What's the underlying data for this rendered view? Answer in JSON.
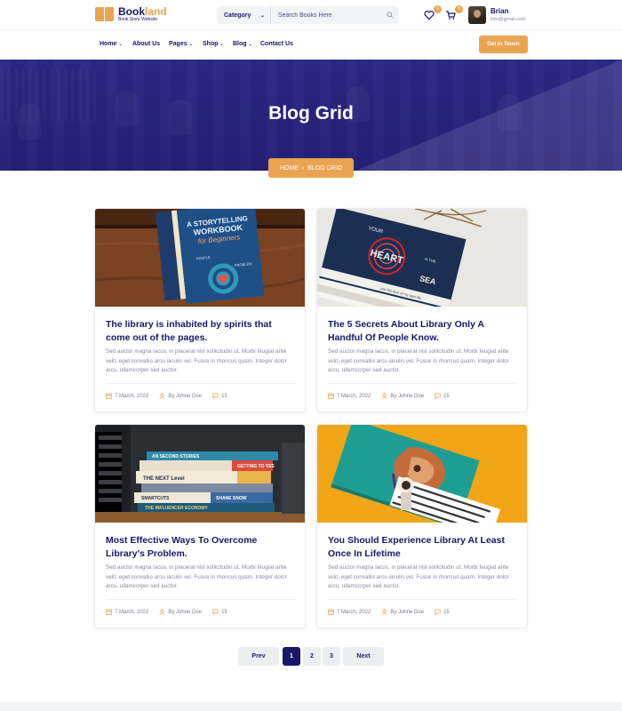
{
  "brand": {
    "name_part1": "Book",
    "name_part2": "land",
    "tagline": "Book Store Website"
  },
  "search": {
    "category_label": "Category",
    "placeholder": "Search Books Here"
  },
  "header": {
    "wishlist_count": "0",
    "cart_count": "5",
    "user_name": "Brian",
    "user_email": "info@gmail.com"
  },
  "nav": {
    "items": [
      {
        "label": "Home"
      },
      {
        "label": "About Us"
      },
      {
        "label": "Pages"
      },
      {
        "label": "Shop"
      },
      {
        "label": "Blog"
      },
      {
        "label": "Contact Us"
      }
    ],
    "cta_label": "Get In Touch"
  },
  "hero": {
    "title": "Blog Grid",
    "breadcrumb_home": "HOME",
    "breadcrumb_current": "BLOG GRID"
  },
  "posts": [
    {
      "title": "The library is inhabited by spirits that come out of the pages.",
      "excerpt": "Sed auctor magna lacus, in placerat nisl sollicitudin ut. Morbi feugiat ante velit, eget convallis arcu iaculis vel. Fusce in rhoncus quam. Integer dolor arcu, ullamcorper sed auctor.",
      "date": "7 March, 2022",
      "author": "By Johne Doe",
      "comments": "15"
    },
    {
      "title": "The 5 Secrets About Library Only A Handful Of People Know.",
      "excerpt": "Sed auctor magna lacus, in placerat nisl sollicitudin ut. Morbi feugiat ante velit, eget convallis arcu iaculis vel. Fusce in rhoncus quam. Integer dolor arcu, ullamcorper sed auctor.",
      "date": "7 March, 2022",
      "author": "By Johne Doe",
      "comments": "15"
    },
    {
      "title": "Most Effective Ways To Overcome Library's Problem.",
      "excerpt": "Sed auctor magna lacus, in placerat nisl sollicitudin ut. Morbi feugiat ante velit, eget convallis arcu iaculis vel. Fusce in rhoncus quam. Integer dolor arcu, ullamcorper sed auctor.",
      "date": "7 March, 2022",
      "author": "By Johne Doe",
      "comments": "15"
    },
    {
      "title": "You Should Experience Library At Least Once In Lifetime",
      "excerpt": "Sed auctor magna lacus, in placerat nisl sollicitudin ut. Morbi feugiat ante velit, eget convallis arcu iaculis vel. Fusce in rhoncus quam. Integer dolor arcu, ullamcorper sed auctor.",
      "date": "7 March, 2022",
      "author": "By Johne Doe",
      "comments": "15"
    }
  ],
  "book_covers": {
    "workbook_line1": "A STORYTELLING",
    "workbook_line2": "WORKBOOK",
    "workbook_line3": "for Beginners",
    "workbook_people": "PEOPLE",
    "workbook_problem": "PROBLEM",
    "heart_your": "YOUR",
    "heart_main": "HEART",
    "heart_is_the": "IS THE",
    "heart_sea": "SEA",
    "heart_tagline": "you the love of my own life",
    "stack_b1": "AN SECOND STORIES",
    "stack_b2": "THE NEXT Level",
    "stack_b3": "SMARTCUTS",
    "stack_b4": "THE INFLUENCER ECONOMY",
    "stack_b5": "GETTING TO YES",
    "stack_b6": "SHANE SNOW"
  },
  "pagination": {
    "prev": "Prev",
    "pages": [
      "1",
      "2",
      "3"
    ],
    "next": "Next",
    "current": "1"
  },
  "colors": {
    "primary": "#1a1668",
    "accent": "#eaa451",
    "muted_text": "#8a8aa0"
  }
}
